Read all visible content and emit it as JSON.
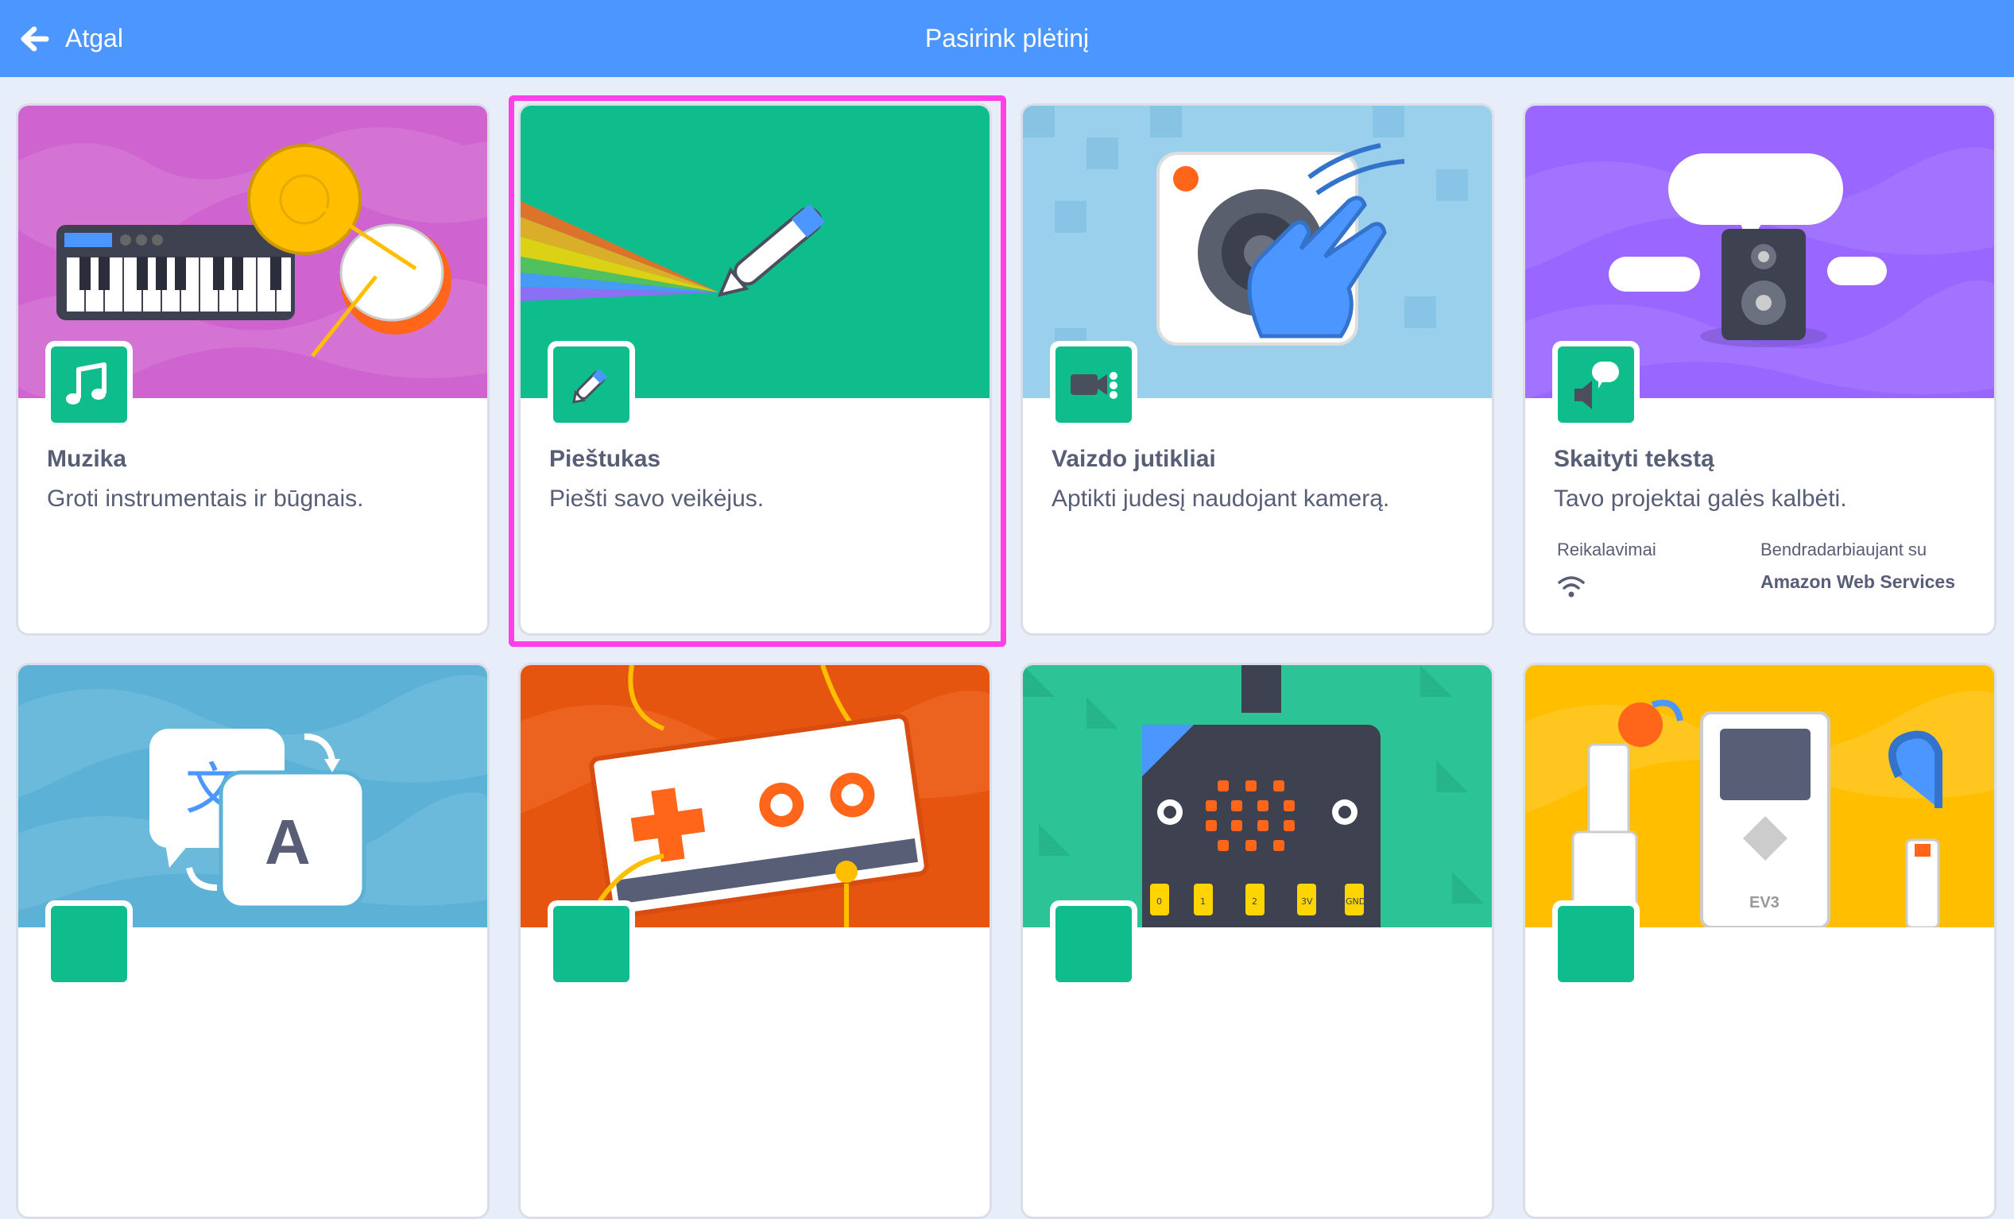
{
  "header": {
    "back_label": "Atgal",
    "title": "Pasirink plėtinį"
  },
  "extensions": [
    {
      "title": "Muzika",
      "description": "Groti instrumentais ir būgnais.",
      "icon": "music-notes-icon"
    },
    {
      "title": "Pieštukas",
      "description": "Piešti savo veikėjus.",
      "icon": "pen-icon",
      "selected": true
    },
    {
      "title": "Vaizdo jutikliai",
      "description": "Aptikti judesį naudojant kamerą.",
      "icon": "video-sensing-icon"
    },
    {
      "title": "Skaityti tekstą",
      "description": "Tavo projektai galės kalbėti.",
      "icon": "text-to-speech-icon",
      "requirements_label": "Reikalavimai",
      "collaboration_label": "Bendradarbiaujant su",
      "collaborator": "Amazon Web Services",
      "requirement_icon": "wifi-icon"
    }
  ],
  "second_row": [
    {
      "name": "translate",
      "icon": "translate-icon"
    },
    {
      "name": "makey-makey",
      "icon": "makey-makey-icon"
    },
    {
      "name": "microbit",
      "icon": "microbit-icon"
    },
    {
      "name": "lego-ev3",
      "icon": "ev3-icon"
    }
  ],
  "microbit_pin_labels": [
    "0",
    "1",
    "2",
    "3V",
    "GND"
  ],
  "ev3_label": "EV3",
  "translate_glyphs": {
    "source": "文",
    "target": "A"
  },
  "colors": {
    "header": "#4c97ff",
    "selection": "#ff40e8",
    "extension_green": "#0fbd8c"
  }
}
